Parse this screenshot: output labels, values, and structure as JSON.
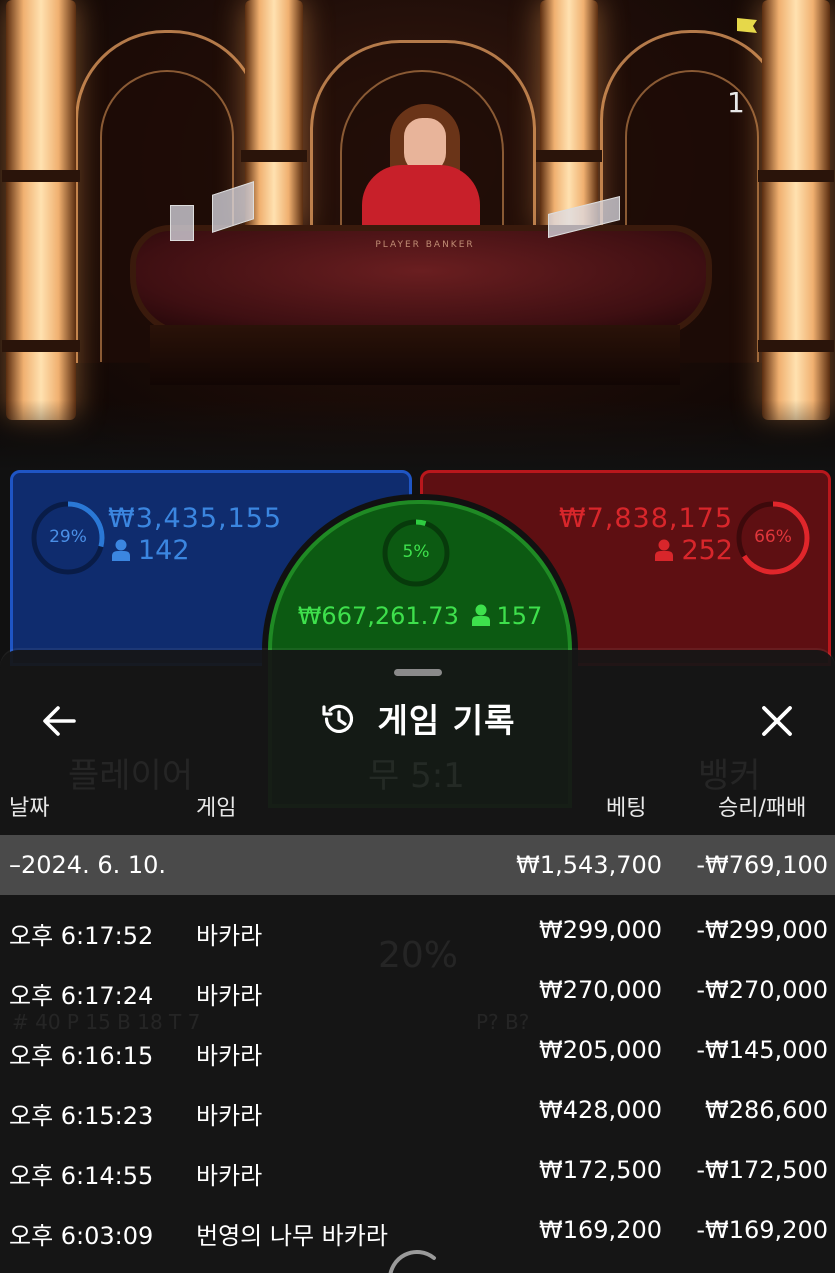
{
  "video": {
    "table_label": "PLAYER   BANKER",
    "round_number": "1"
  },
  "bets": {
    "player": {
      "percent_label": "29%",
      "percent": 29,
      "amount": "₩3,435,155",
      "players": "142",
      "color": "#2a78d6"
    },
    "banker": {
      "percent_label": "66%",
      "percent": 66,
      "amount": "₩7,838,175",
      "players": "252",
      "color": "#e0262b"
    },
    "tie": {
      "percent_label": "5%",
      "percent": 5,
      "amount": "₩667,261.73",
      "players": "157",
      "color": "#2ecc40"
    }
  },
  "history": {
    "title": "게임 기록",
    "columns": {
      "date": "날짜",
      "game": "게임",
      "bet": "베팅",
      "win_loss": "승리/패배"
    },
    "group": {
      "date": "–2024. 6. 10.",
      "bet": "₩1,543,700",
      "win_loss": "-₩769,100"
    },
    "rows": [
      {
        "time": "오후 6:17:52",
        "game": "바카라",
        "bet": "₩299,000",
        "win_loss": "-₩299,000"
      },
      {
        "time": "오후 6:17:24",
        "game": "바카라",
        "bet": "₩270,000",
        "win_loss": "-₩270,000"
      },
      {
        "time": "오후 6:16:15",
        "game": "바카라",
        "bet": "₩205,000",
        "win_loss": "-₩145,000"
      },
      {
        "time": "오후 6:15:23",
        "game": "바카라",
        "bet": "₩428,000",
        "win_loss": "₩286,600"
      },
      {
        "time": "오후 6:14:55",
        "game": "바카라",
        "bet": "₩172,500",
        "win_loss": "-₩172,500"
      },
      {
        "time": "오후 6:03:09",
        "game": "번영의 나무 바카라",
        "bet": "₩169,200",
        "win_loss": "-₩169,200"
      }
    ]
  },
  "background_ghost": {
    "player_label": "플레이어",
    "tie_label": "무 5:1",
    "banker_label": "뱅커",
    "pct": "20%",
    "stats": "# 40   P 15   B 18   T 7",
    "predict": "P?   B?"
  },
  "icons": {
    "back": "arrow-left-icon",
    "history": "history-clock-icon",
    "close": "close-icon",
    "person": "person-icon",
    "flag": "flag-icon"
  }
}
